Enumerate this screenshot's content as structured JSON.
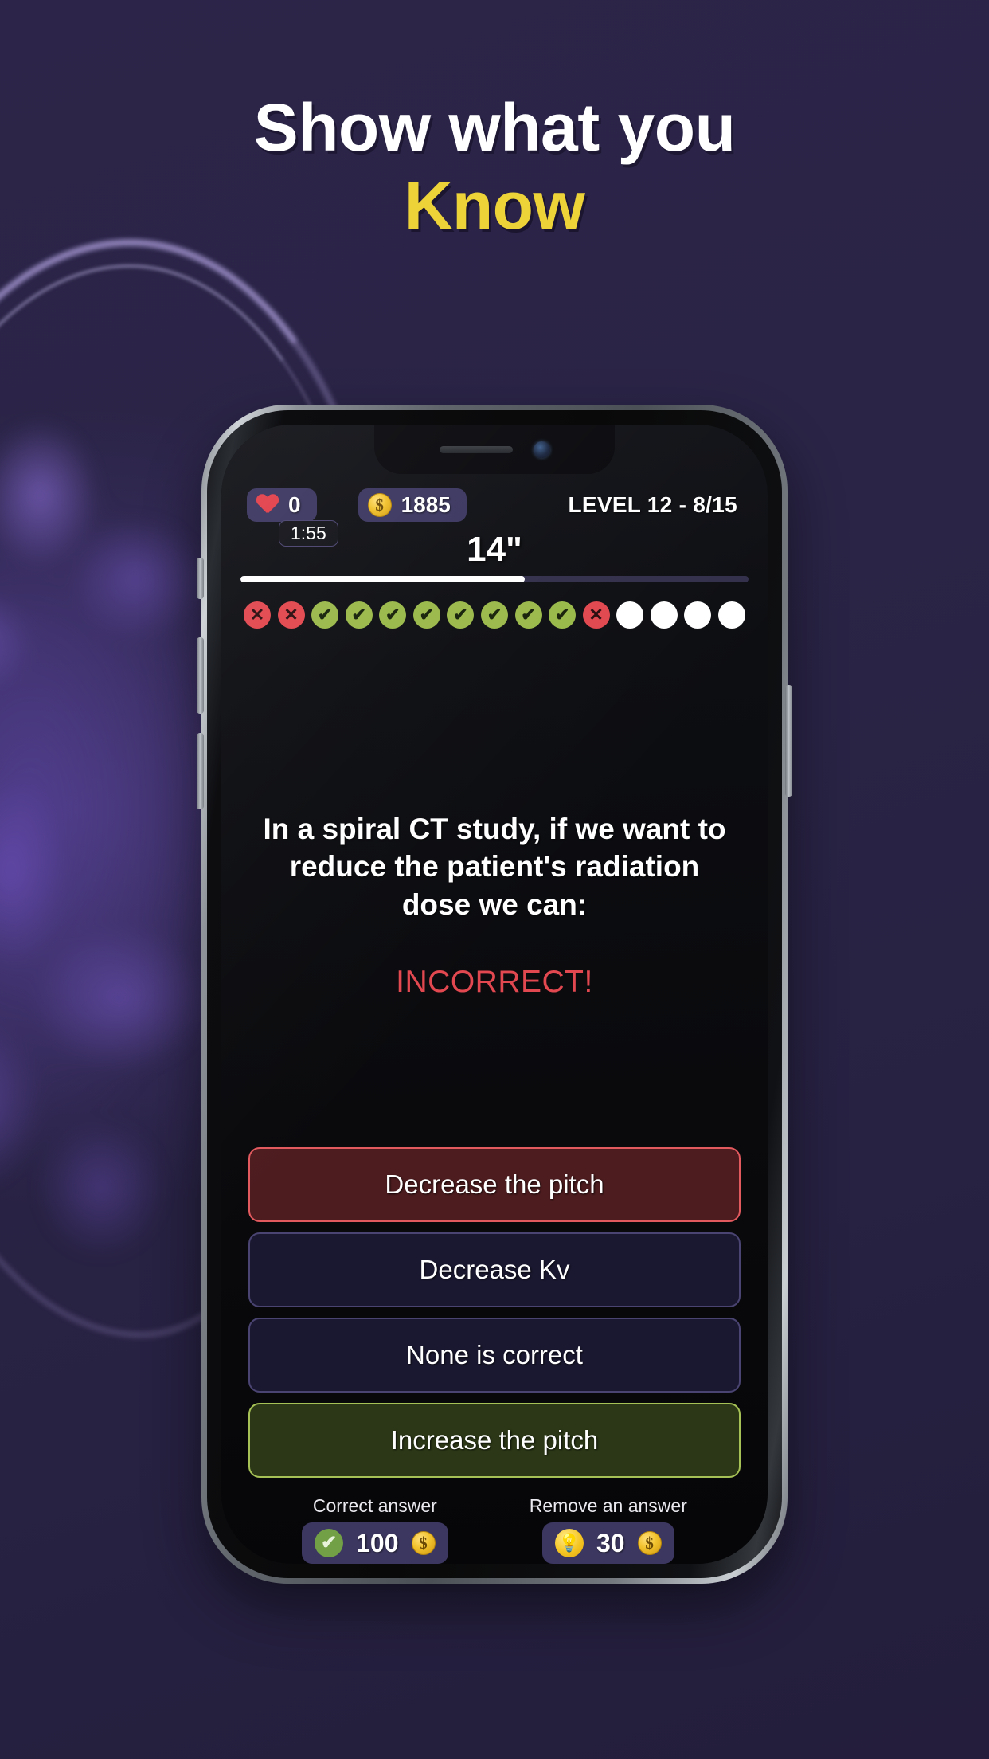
{
  "headline": {
    "line1": "Show what you",
    "line2": "Know",
    "accent_color": "#eed338",
    "line1_color": "#ffffff"
  },
  "background": {
    "color": "#2a2446",
    "scan_icon": "brain-scan-image",
    "scan_tint": "#7c5cd2"
  },
  "phone": {
    "frame_color": "#8e9399",
    "screen_bg": "#0a0a0d",
    "notch_icons": [
      "earpiece-speaker",
      "front-camera"
    ]
  },
  "game": {
    "hud": {
      "lives_icon": "heart-icon",
      "lives": "0",
      "timer": "1:55",
      "coins_icon": "coin-icon",
      "coins": "1885",
      "level_label": "LEVEL 12 - 8/15"
    },
    "countdown": {
      "value": "14\"",
      "progress_percent": 56,
      "fill_color": "#ffffff",
      "track_color": "#33304c"
    },
    "dots": [
      {
        "state": "wrong",
        "glyph": "✕"
      },
      {
        "state": "wrong",
        "glyph": "✕"
      },
      {
        "state": "right",
        "glyph": "✔"
      },
      {
        "state": "right",
        "glyph": "✔"
      },
      {
        "state": "right",
        "glyph": "✔"
      },
      {
        "state": "right",
        "glyph": "✔"
      },
      {
        "state": "right",
        "glyph": "✔"
      },
      {
        "state": "right",
        "glyph": "✔"
      },
      {
        "state": "right",
        "glyph": "✔"
      },
      {
        "state": "right",
        "glyph": "✔"
      },
      {
        "state": "wrong",
        "glyph": "✕"
      },
      {
        "state": "pending",
        "glyph": ""
      },
      {
        "state": "pending",
        "glyph": ""
      },
      {
        "state": "pending",
        "glyph": ""
      },
      {
        "state": "pending",
        "glyph": ""
      }
    ],
    "question": "In a spiral CT study, if we want to reduce the patient's radiation dose we can:",
    "verdict": "INCORRECT!",
    "verdict_color": "#e2484f",
    "answers": [
      {
        "label": "Decrease the pitch",
        "state": "selected-wrong"
      },
      {
        "label": "Decrease Kv",
        "state": "default"
      },
      {
        "label": "None is correct",
        "state": "default"
      },
      {
        "label": "Increase the pitch",
        "state": "correct"
      }
    ],
    "powerups": [
      {
        "label": "Correct answer",
        "icon": "green-check-icon",
        "cost": "100",
        "currency_icon": "coin-icon"
      },
      {
        "label": "Remove an answer",
        "icon": "lightbulb-icon",
        "cost": "30",
        "currency_icon": "coin-icon"
      }
    ]
  }
}
